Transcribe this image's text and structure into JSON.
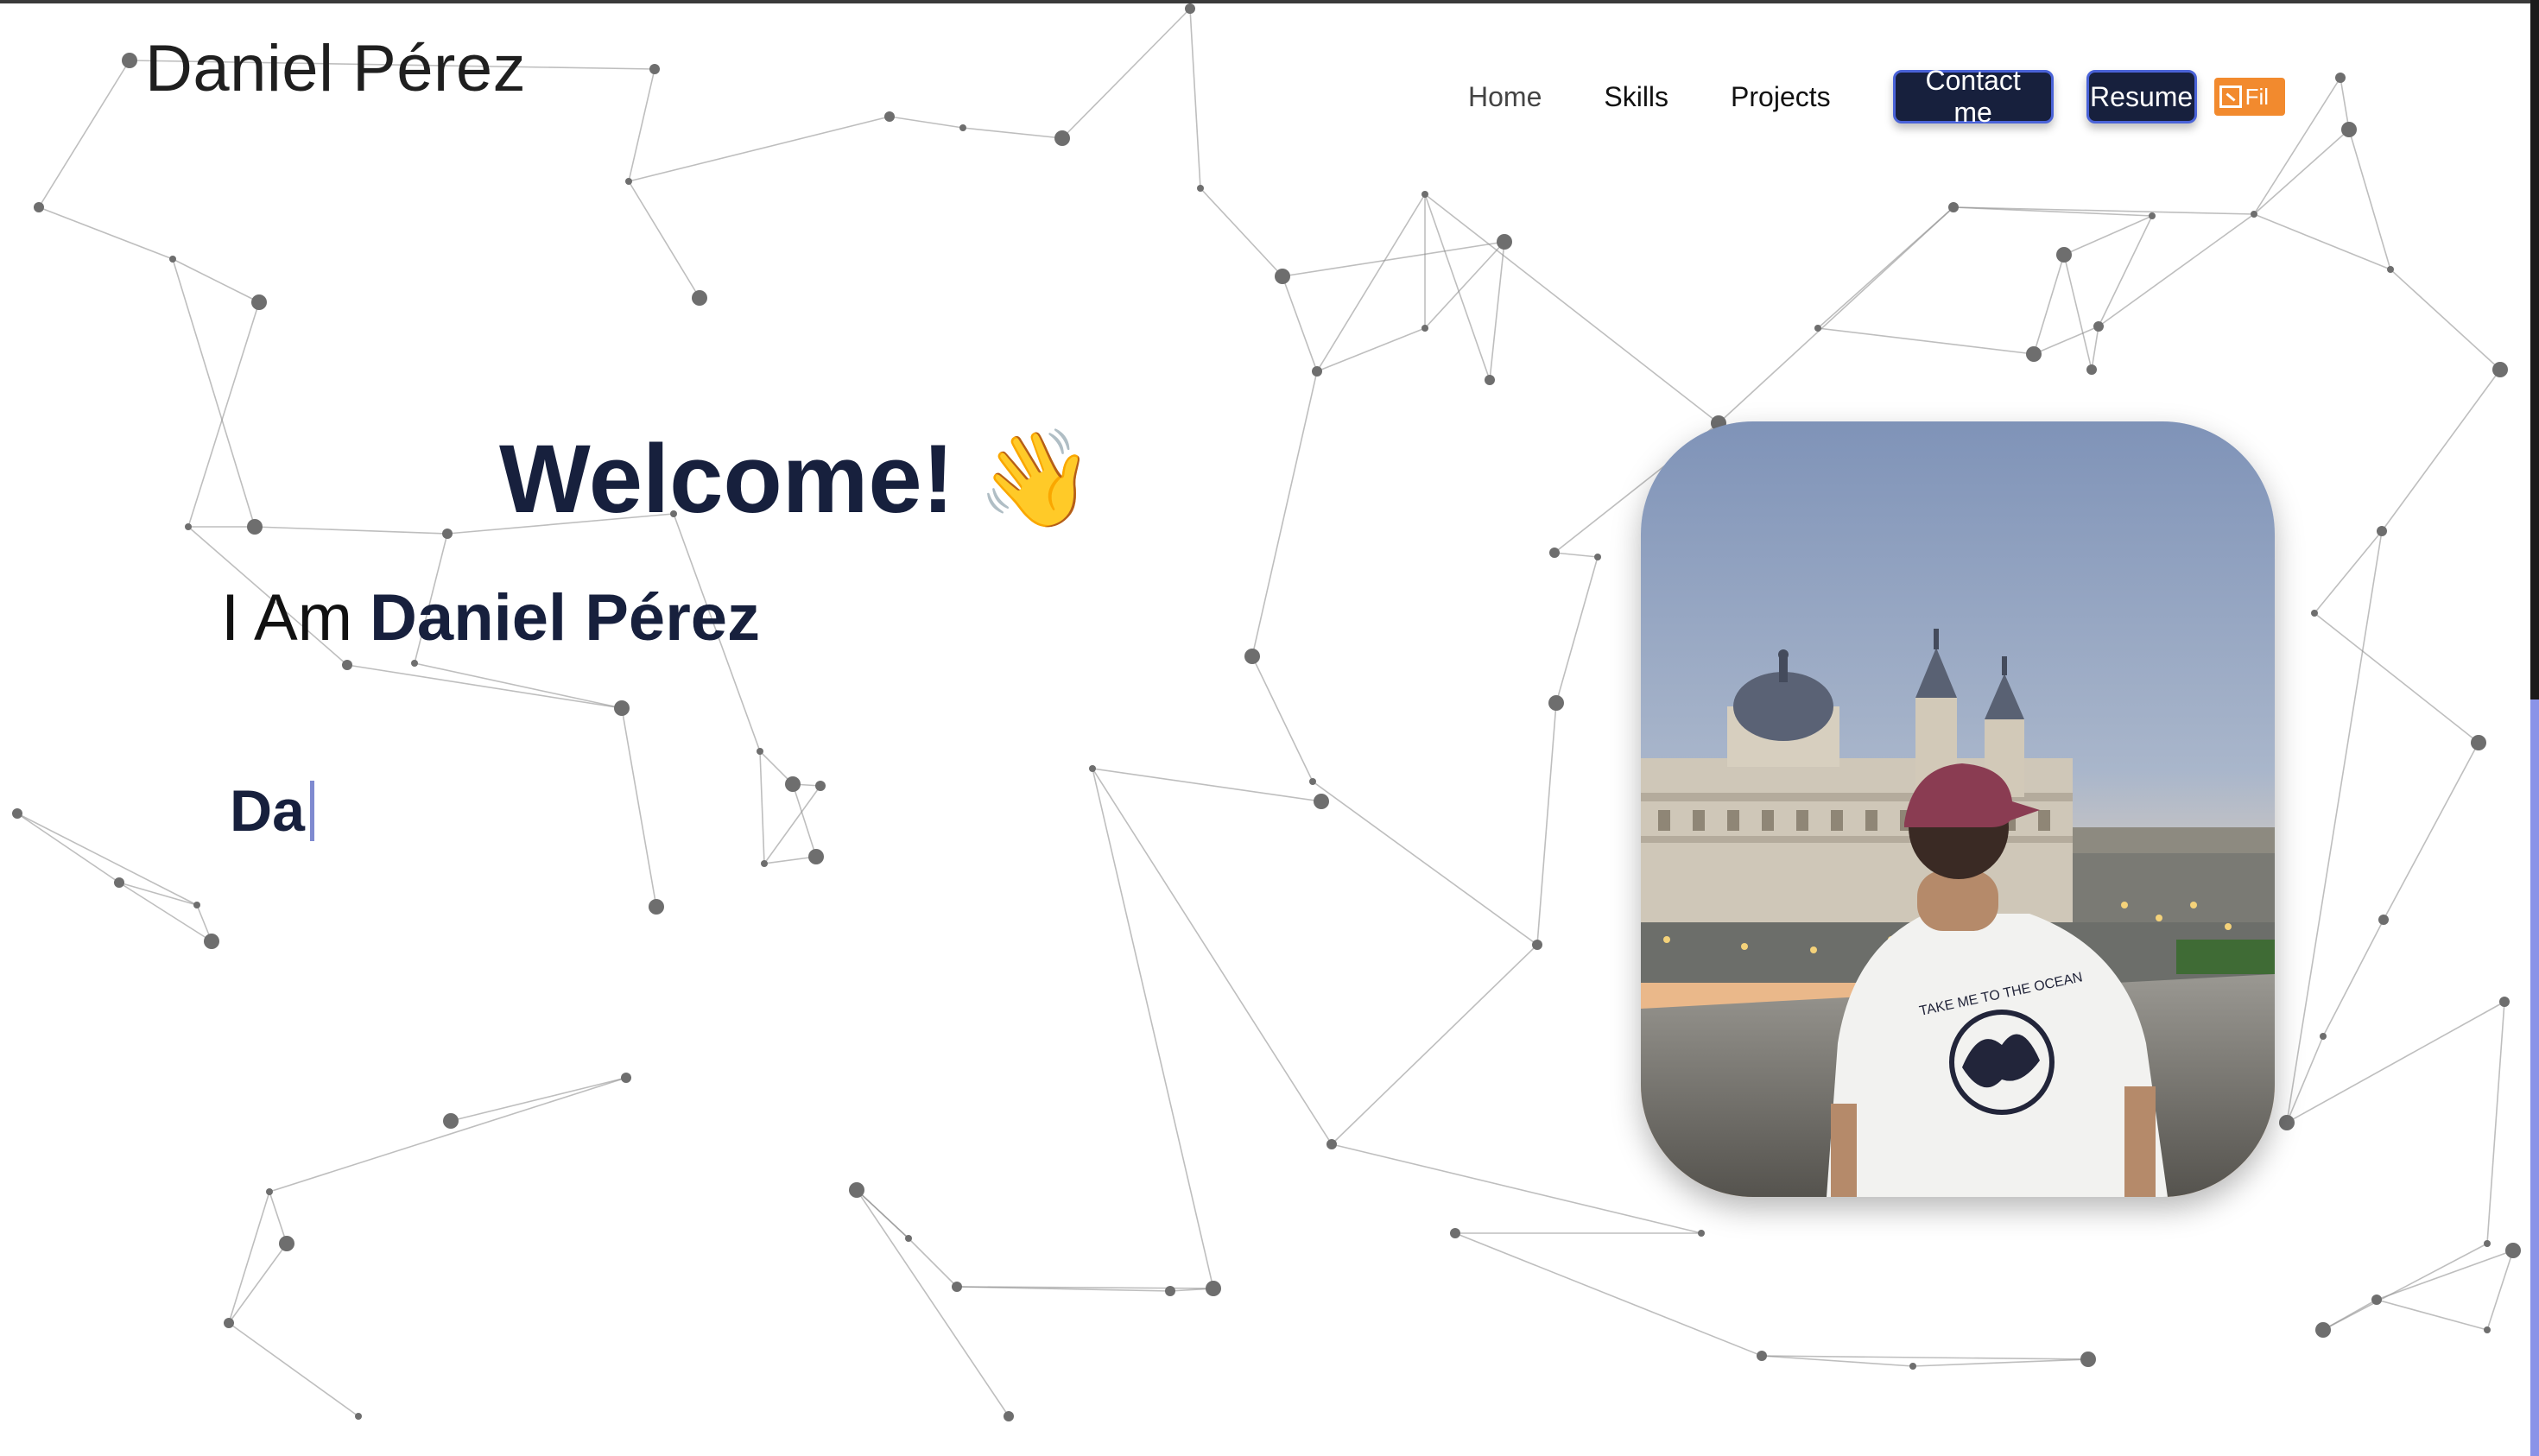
{
  "header": {
    "brand": "Daniel Pérez",
    "nav": [
      {
        "label": "Home"
      },
      {
        "label": "Skills"
      },
      {
        "label": "Projects"
      }
    ],
    "contact_label": "Contact me",
    "resume_label": "Resume",
    "file_badge_label": "Fil"
  },
  "hero": {
    "welcome": "Welcome!",
    "wave_emoji": "👋",
    "intro_prefix": "I Am",
    "intro_name": "Daniel Pérez",
    "typed_text": "Da"
  },
  "photo": {
    "shirt_text": "TAKE ME TO THE OCEAN"
  },
  "colors": {
    "accent_navy": "#17203d",
    "button_border": "#4a63d8",
    "file_badge": "#f28a2e",
    "caret": "#7f8ad0",
    "scroll_thumb": "#8a93e8"
  },
  "icons": {
    "file_badge_icon": "external-file-icon",
    "wave_icon": "waving-hand-icon"
  }
}
